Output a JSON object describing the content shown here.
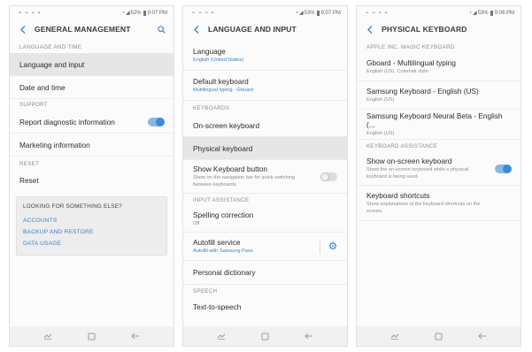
{
  "status": {
    "left_icons": "⌁ ⌁ ⌁ ▪",
    "phone1_battery": "52%",
    "phone1_time": "9:07 PM",
    "phone2_battery": "53%",
    "phone2_time": "9:07 PM",
    "phone3_battery": "53%",
    "phone3_time": "9:06 PM"
  },
  "phone1": {
    "title": "GENERAL MANAGEMENT",
    "sections": {
      "language_and_time": "LANGUAGE AND TIME",
      "support": "SUPPORT",
      "reset": "RESET"
    },
    "items": {
      "language_input": "Language and input",
      "date_time": "Date and time",
      "report_diag": "Report diagnostic information",
      "marketing": "Marketing information",
      "reset": "Reset"
    },
    "report_diag_enabled": true,
    "suggest": {
      "title": "LOOKING FOR SOMETHING ELSE?",
      "links": [
        "ACCOUNTS",
        "BACKUP AND RESTORE",
        "DATA USAGE"
      ]
    }
  },
  "phone2": {
    "title": "LANGUAGE AND INPUT",
    "items": {
      "language": {
        "title": "Language",
        "sub": "English (United States)"
      },
      "default_keyboard": {
        "title": "Default keyboard",
        "sub": "Multilingual typing - Gboard"
      },
      "onscreen_keyboard": {
        "title": "On-screen keyboard"
      },
      "physical_keyboard": {
        "title": "Physical keyboard"
      },
      "show_keyboard_button": {
        "title": "Show Keyboard button",
        "sub": "Show on the navigation bar for quick switching between keyboards."
      },
      "spelling_correction": {
        "title": "Spelling correction",
        "sub": "Off"
      },
      "autofill": {
        "title": "Autofill service",
        "sub": "Autofill with Samsung Pass"
      },
      "personal_dictionary": {
        "title": "Personal dictionary"
      },
      "text_to_speech": {
        "title": "Text-to-speech"
      }
    },
    "sections": {
      "keyboards": "KEYBOARDS",
      "input_assistance": "INPUT ASSISTANCE",
      "speech": "SPEECH"
    },
    "show_keyboard_button_enabled": false
  },
  "phone3": {
    "title": "PHYSICAL KEYBOARD",
    "sections": {
      "apple": "APPLE INC. MAGIC KEYBOARD",
      "assistance": "KEYBOARD ASSISTANCE"
    },
    "items": {
      "gboard": {
        "title": "Gboard - Multilingual typing",
        "sub": "English (US), Colemak style"
      },
      "samsung_keyboard": {
        "title": "Samsung Keyboard - English (US)",
        "sub": "English (US)"
      },
      "samsung_neural": {
        "title": "Samsung Keyboard Neural Beta - English (...",
        "sub": "English (US)"
      },
      "show_onscreen": {
        "title": "Show on-screen keyboard",
        "sub": "Show the on-screen keyboard while a physical keyboard is being used."
      },
      "keyboard_shortcuts": {
        "title": "Keyboard shortcuts",
        "sub": "Show explanations of the keyboard shortcuts on the screen."
      }
    },
    "show_onscreen_enabled": true
  },
  "colors": {
    "accent": "#3d82c4",
    "toggle_on": "#3d8bd6",
    "selected_row": "#e6e6e6"
  },
  "icons": {
    "back": "back-arrow-icon",
    "search": "search-icon",
    "settings": "gear-icon",
    "recents": "recent-apps-icon",
    "home": "home-icon",
    "nav_back": "nav-back-icon"
  }
}
